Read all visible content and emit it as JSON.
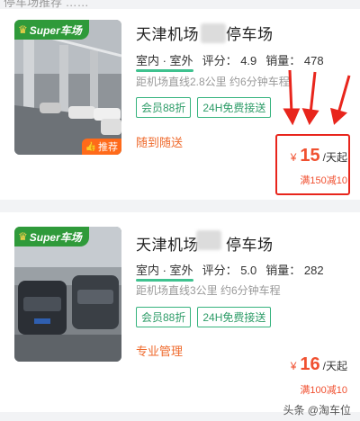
{
  "top_partial": "停车场推荐 ……",
  "listings": [
    {
      "title_prefix": "天津机场",
      "title_suffix": "停车场",
      "super_badge": "Super车场",
      "recommend_badge": "推荐",
      "location_type": "室内 · 室外",
      "rating_label": "评分：",
      "rating": "4.9",
      "sales_label": "销量：",
      "sales": "478",
      "distance": "距机场直线2.8公里 约6分钟车程",
      "tags": [
        "会员88折",
        "24H免费接送"
      ],
      "promo": "随到随送",
      "currency": "¥",
      "price": "15",
      "price_unit": "/天起",
      "discount": "满150减10"
    },
    {
      "title_prefix": "天津机场",
      "title_suffix": "停车场",
      "super_badge": "Super车场",
      "location_type": "室内 · 室外",
      "rating_label": "评分：",
      "rating": "5.0",
      "sales_label": "销量：",
      "sales": "282",
      "distance": "距机场直线3公里 约6分钟车程",
      "tags": [
        "会员88折",
        "24H免费接送"
      ],
      "promo": "专业管理",
      "currency": "¥",
      "price": "16",
      "price_unit": "/天起",
      "discount": "满100减10"
    }
  ],
  "watermark": "头条 @淘车位",
  "colors": {
    "accent_green": "#2f9a3a",
    "price_red": "#f05030",
    "tag_green": "#36b37e",
    "highlight_red": "#e8251c"
  }
}
